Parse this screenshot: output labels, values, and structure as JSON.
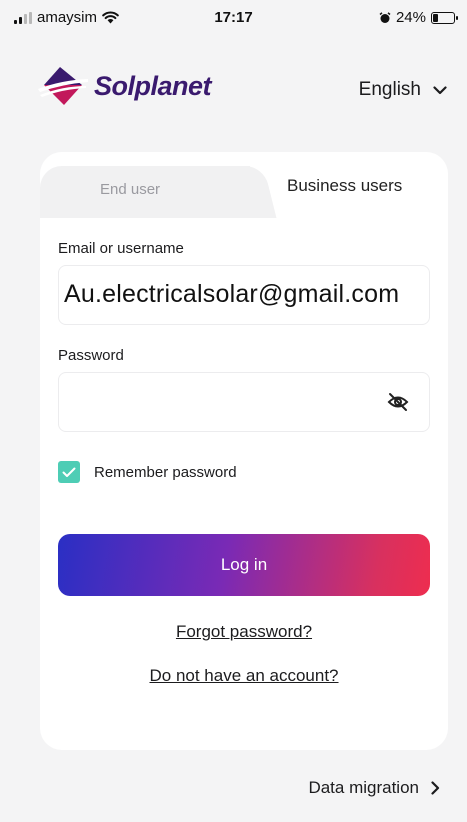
{
  "status_bar": {
    "carrier": "amaysim",
    "time": "17:17",
    "battery": "24%",
    "battery_level": 0.24
  },
  "header": {
    "brand": "Solplanet",
    "language": "English",
    "brand_colors": {
      "purple": "#3a1a6e",
      "magenta": "#c2185b"
    }
  },
  "tabs": {
    "end_user": "End user",
    "business": "Business users",
    "selected": "Business users"
  },
  "form": {
    "email_label": "Email or username",
    "email_value": "Au.electricalsolar@gmail.com",
    "password_label": "Password",
    "password_value": "",
    "remember_label": "Remember password",
    "remember_checked": true,
    "login_label": "Log in",
    "forgot_label": "Forgot password?",
    "no_account_label": "Do not have an account?"
  },
  "footer": {
    "migration_label": "Data migration"
  },
  "colors": {
    "accent_teal": "#4ecdb5",
    "button_gradient_start": "#2a2fc4",
    "button_gradient_end": "#ee2d4f"
  }
}
